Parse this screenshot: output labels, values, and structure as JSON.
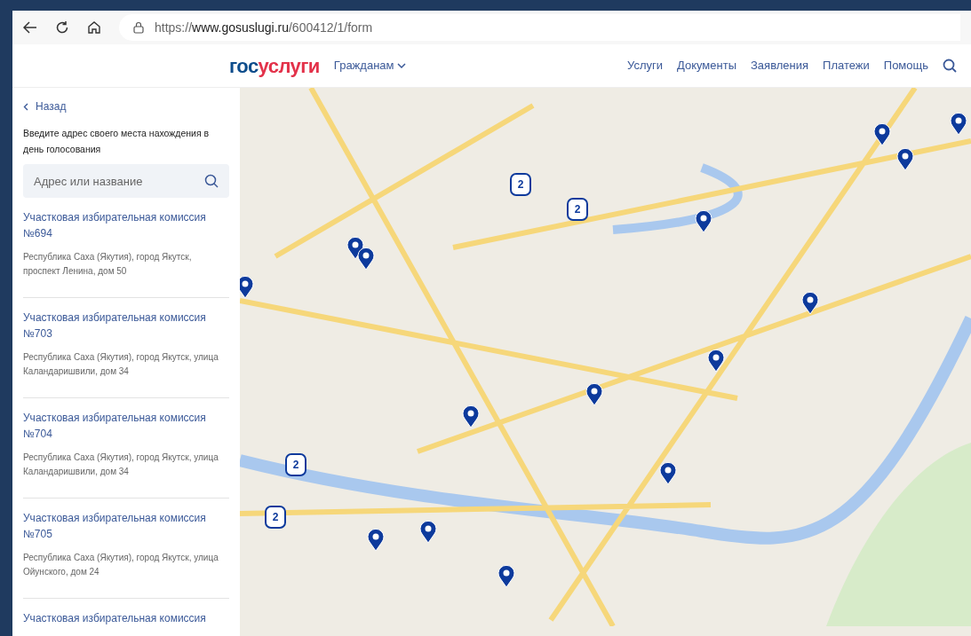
{
  "browser": {
    "url_scheme": "https://",
    "url_host": "www.gosuslugi.ru",
    "url_path": "/600412/1/form"
  },
  "header": {
    "logo_part1": "гос",
    "logo_part2": "услуги",
    "menu": "Гражданам",
    "nav": [
      "Услуги",
      "Документы",
      "Заявления",
      "Платежи",
      "Помощь"
    ]
  },
  "sidebar": {
    "back": "Назад",
    "prompt": "Введите адрес своего места нахождения в день голосования",
    "search": {
      "placeholder": "Адрес или название"
    },
    "items": [
      {
        "title": "Участковая избирательная комиссия №694",
        "address": "Республика Саха (Якутия), город Якутск, проспект Ленина, дом 50"
      },
      {
        "title": "Участковая избирательная комиссия №703",
        "address": "Республика Саха (Якутия), город Якутск, улица Каландаришвили, дом 34"
      },
      {
        "title": "Участковая избирательная комиссия №704",
        "address": "Республика Саха (Якутия), город Якутск, улица Каландаришвили, дом 34"
      },
      {
        "title": "Участковая избирательная комиссия №705",
        "address": "Республика Саха (Якутия), город Якутск, улица Ойунского, дом 24"
      },
      {
        "title": "Участковая избирательная комиссия"
      }
    ]
  },
  "map": {
    "markers": [
      {
        "kind": "pin"
      },
      {
        "kind": "pin"
      },
      {
        "kind": "pin"
      },
      {
        "kind": "pin"
      },
      {
        "kind": "pin"
      },
      {
        "kind": "pin"
      },
      {
        "kind": "pin"
      },
      {
        "kind": "pin"
      },
      {
        "kind": "pin"
      },
      {
        "kind": "pin"
      },
      {
        "kind": "pin"
      },
      {
        "kind": "pin"
      },
      {
        "kind": "pin"
      },
      {
        "kind": "pin"
      },
      {
        "kind": "pin"
      },
      {
        "kind": "cluster",
        "count": "2"
      },
      {
        "kind": "cluster",
        "count": "2"
      },
      {
        "kind": "cluster",
        "count": "2"
      },
      {
        "kind": "cluster",
        "count": "2"
      }
    ]
  }
}
